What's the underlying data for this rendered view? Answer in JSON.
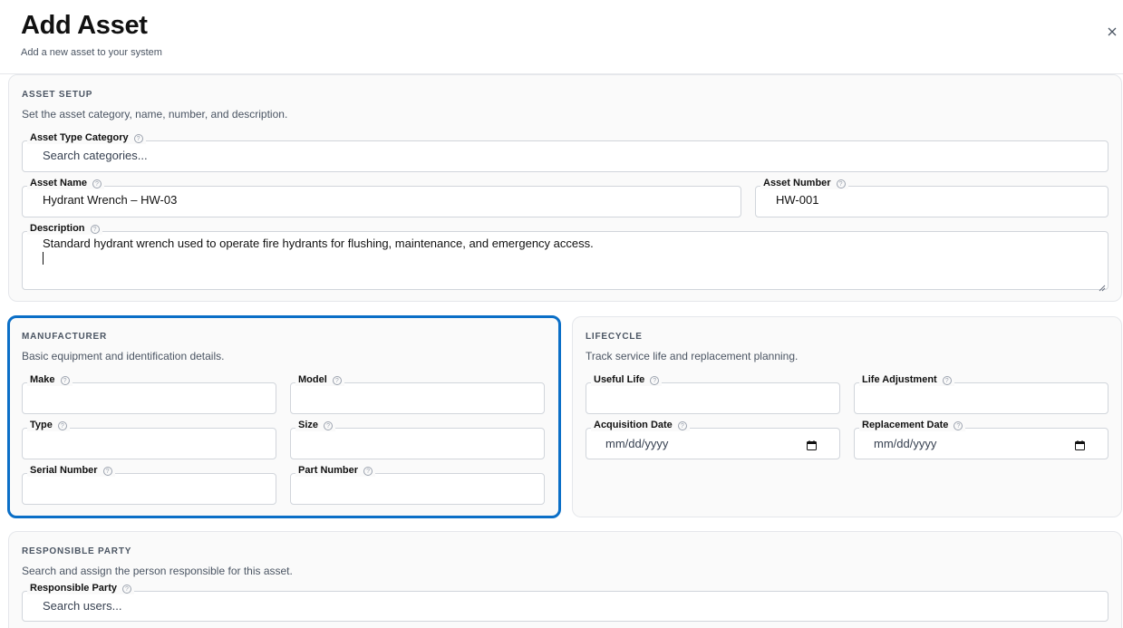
{
  "dialog": {
    "title": "Add Asset",
    "subtitle": "Add a new asset to your system"
  },
  "asset_setup": {
    "title": "ASSET SETUP",
    "description": "Set the asset category, name, number, and description.",
    "type_category": {
      "label": "Asset Type Category",
      "placeholder": "Search categories..."
    },
    "name": {
      "label": "Asset Name",
      "value": "Hydrant Wrench – HW-03"
    },
    "number": {
      "label": "Asset Number",
      "value": "HW-001"
    },
    "desc_field": {
      "label": "Description",
      "value": "Standard hydrant wrench used to operate fire hydrants for flushing, maintenance, and emergency access."
    }
  },
  "manufacturer": {
    "title": "MANUFACTURER",
    "description": "Basic equipment and identification details.",
    "make": {
      "label": "Make",
      "value": ""
    },
    "model": {
      "label": "Model",
      "value": ""
    },
    "type": {
      "label": "Type",
      "value": ""
    },
    "size": {
      "label": "Size",
      "value": ""
    },
    "serial": {
      "label": "Serial Number",
      "value": ""
    },
    "part": {
      "label": "Part Number",
      "value": ""
    }
  },
  "lifecycle": {
    "title": "LIFECYCLE",
    "description": "Track service life and replacement planning.",
    "useful_life": {
      "label": "Useful Life",
      "value": ""
    },
    "life_adjustment": {
      "label": "Life Adjustment",
      "value": ""
    },
    "acquisition": {
      "label": "Acquisition Date",
      "placeholder": "mm/dd/yyyy"
    },
    "replacement": {
      "label": "Replacement Date",
      "placeholder": "mm/dd/yyyy"
    }
  },
  "responsible": {
    "title": "RESPONSIBLE PARTY",
    "description": "Search and assign the person responsible for this asset.",
    "party": {
      "label": "Responsible Party",
      "placeholder": "Search users..."
    }
  },
  "icons": {
    "close": "close-icon",
    "help": "help-circle-icon",
    "calendar": "calendar-icon",
    "resize": "resize-handle-icon"
  },
  "colors": {
    "accent_focus": "#0b6fc7",
    "card_bg": "#fafafa",
    "border": "#d1d5db"
  }
}
